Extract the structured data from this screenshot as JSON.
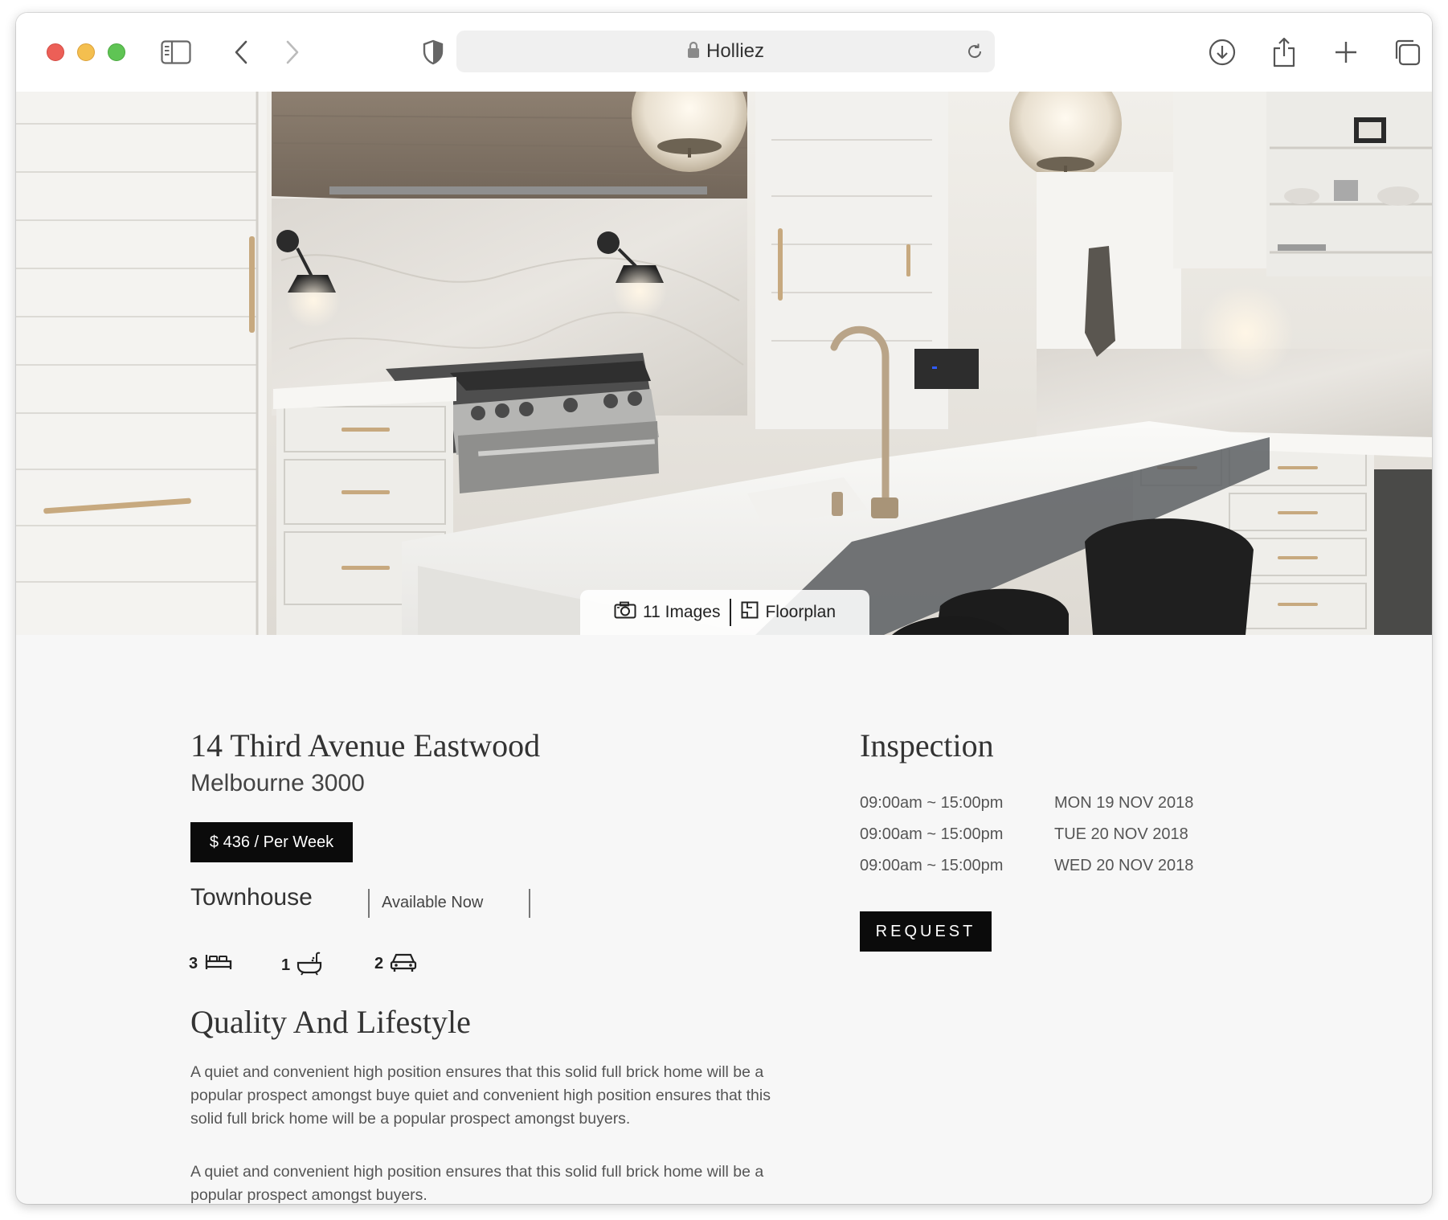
{
  "browser": {
    "url_title": "Holliez",
    "icons": {
      "sidebar": "sidebar-icon",
      "back": "chevron-left-icon",
      "forward": "chevron-right-icon",
      "shield": "shield-icon",
      "lock": "lock-icon",
      "reload": "reload-icon",
      "download": "download-icon",
      "share": "share-icon",
      "new_tab": "plus-icon",
      "tabs": "tabs-overview-icon"
    }
  },
  "hero": {
    "images_label": "11 Images",
    "floorplan_label": "Floorplan",
    "camera_icon": "camera-icon",
    "floorplan_icon": "floorplan-icon"
  },
  "listing": {
    "address": "14 Third Avenue Eastwood",
    "city": "Melbourne 3000",
    "price": "$ 436 / Per Week",
    "property_type": "Townhouse",
    "availability": "Available  Now",
    "features": [
      {
        "count": "3",
        "icon": "bed-icon"
      },
      {
        "count": "1",
        "icon": "bath-icon"
      },
      {
        "count": "2",
        "icon": "car-icon"
      }
    ],
    "section_title": "Quality And Lifestyle",
    "paragraphs": [
      "A quiet and convenient high position ensures that this solid full brick home will be a popular prospect amongst buye quiet and convenient high position ensures that this solid full brick home will be a popular prospect amongst buyers.",
      "A quiet and convenient high position ensures that this solid full brick home will be a popular prospect amongst buyers."
    ]
  },
  "inspection": {
    "title": "Inspection",
    "slots": [
      {
        "time": "09:00am ~ 15:00pm",
        "date": "MON 19 NOV 2018"
      },
      {
        "time": "09:00am ~ 15:00pm",
        "date": "TUE 20 NOV 2018"
      },
      {
        "time": "09:00am ~ 15:00pm",
        "date": "WED 20 NOV 2018"
      }
    ],
    "request_label": "REQUEST"
  },
  "colors": {
    "close": "#ec5f57",
    "minimize": "#f4bf4f",
    "zoom": "#5fc454",
    "button_bg": "#0b0b0b",
    "page_bg": "#f7f7f7"
  }
}
